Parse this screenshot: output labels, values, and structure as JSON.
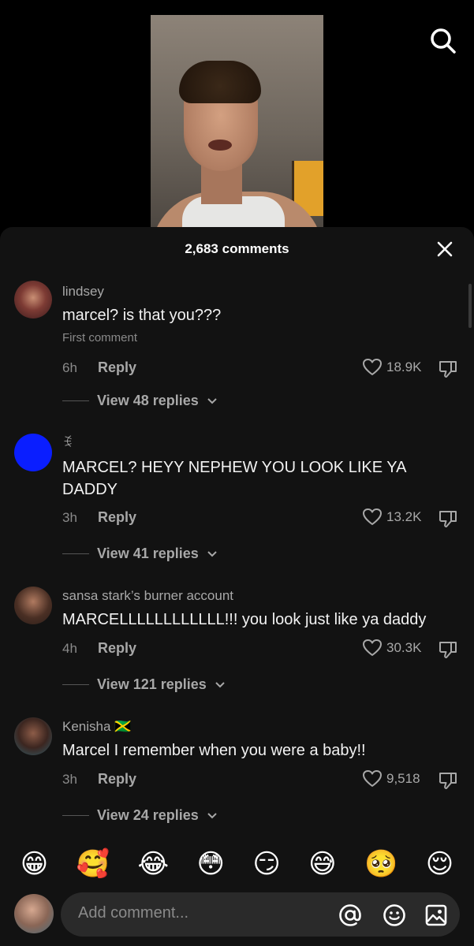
{
  "header": {
    "comments_count": "2,683 comments"
  },
  "comments": [
    {
      "username": "lindsey",
      "text": "marcel? is that you???",
      "sub_label": "First comment",
      "time": "6h",
      "reply_label": "Reply",
      "likes": "18.9K",
      "view_replies": "View 48 replies"
    },
    {
      "username": "ꉂ",
      "text": "MARCEL? HEYY NEPHEW YOU LOOK LIKE YA DADDY",
      "time": "3h",
      "reply_label": "Reply",
      "likes": "13.2K",
      "view_replies": "View 41 replies",
      "avatar_color": "#0a1eff"
    },
    {
      "username": "sansa stark’s burner account",
      "text": "MARCELLLLLLLLLLLL!!! you look just like ya daddy",
      "time": "4h",
      "reply_label": "Reply",
      "likes": "30.3K",
      "view_replies": "View 121 replies"
    },
    {
      "username": "Kenisha 🇯🇲",
      "text": "Marcel I remember when you were a baby!!",
      "time": "3h",
      "reply_label": "Reply",
      "likes": "9,518",
      "view_replies": "View 24 replies"
    }
  ],
  "emoji_bar": [
    "😁",
    "🥰",
    "😂",
    "😳",
    "😏",
    "😅",
    "🥺",
    "😌"
  ],
  "input": {
    "placeholder": "Add comment..."
  },
  "icons": [
    "search-icon",
    "close-icon",
    "heart-icon",
    "dislike-icon",
    "chevron-down-icon",
    "at-icon",
    "emoji-icon",
    "image-icon"
  ],
  "colors": {
    "sheet_bg": "#121212",
    "muted_text": "#a8a8a8",
    "input_bg": "#2a2a2a"
  }
}
